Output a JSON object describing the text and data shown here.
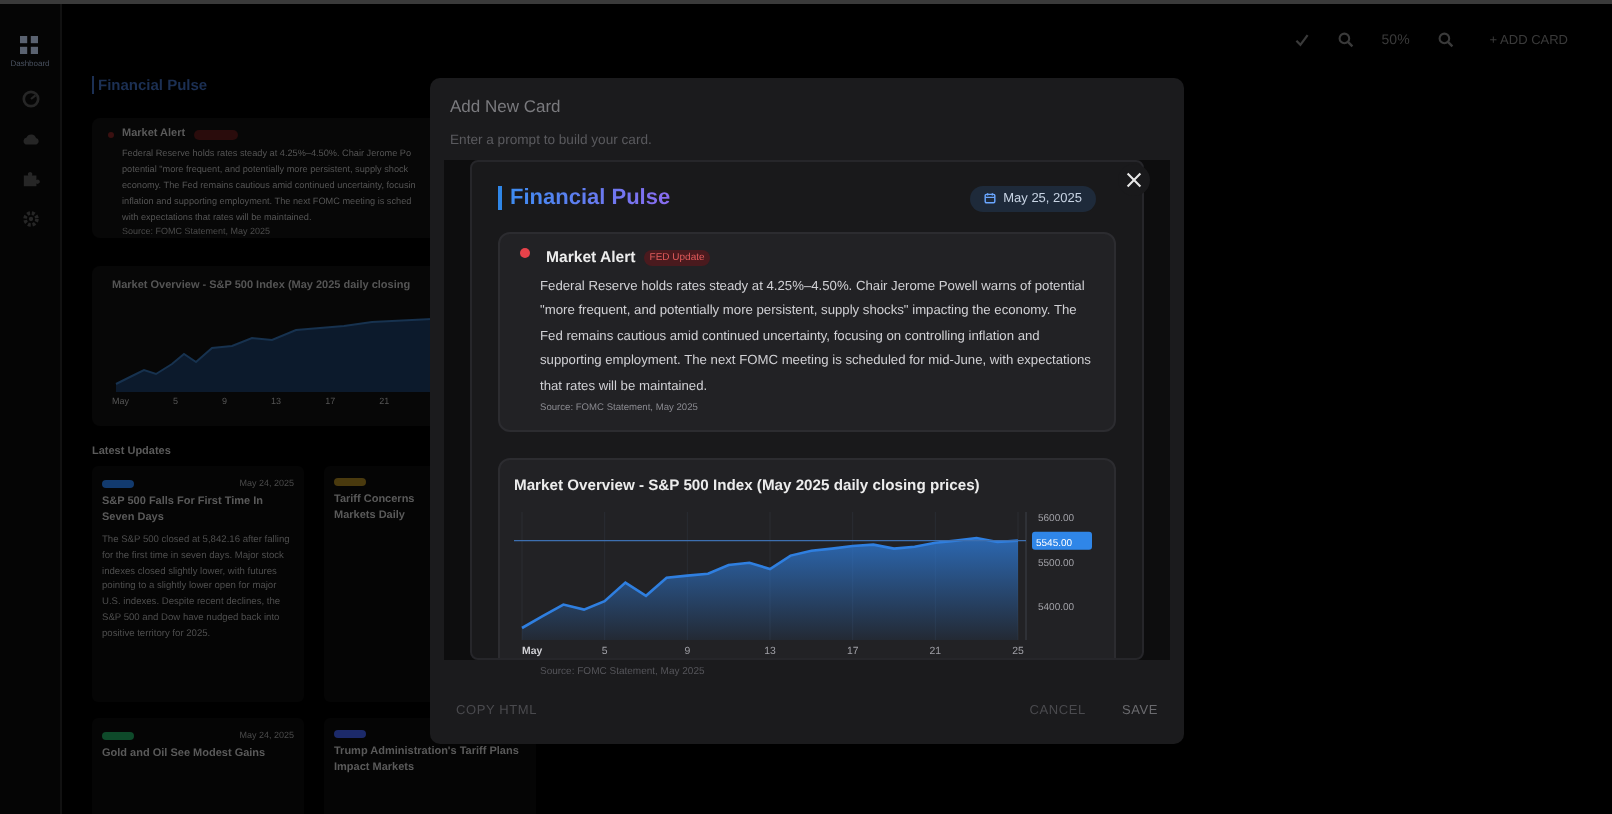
{
  "sidebar": {
    "items": [
      {
        "kind": "grid",
        "label": "Dashboard",
        "selected": true
      },
      {
        "kind": "gauge",
        "selected": false
      },
      {
        "kind": "cloud",
        "selected": false
      },
      {
        "kind": "puzzle",
        "selected": false
      },
      {
        "kind": "gear",
        "selected": false
      }
    ]
  },
  "toolbar": {
    "zoom_level": "50%",
    "add_icon": "+",
    "add_button": "ADD CARD"
  },
  "dashboard": {
    "title": "Financial Pulse",
    "alert": {
      "title": "Market Alert",
      "body_lines": [
        "Federal Reserve holds rates steady at 4.25%–4.50%. Chair Jerome Po",
        "potential \"more frequent, and potentially more persistent, supply shock",
        "economy. The Fed remains cautious amid continued uncertainty, focusin",
        "inflation and supporting employment. The next FOMC meeting is sched",
        "with expectations that rates will be maintained."
      ],
      "source": "Source: FOMC Statement, May 2025"
    },
    "chart": {
      "title": "Market Overview - S&P 500 Index (May 2025 daily closing",
      "axis_labels": [
        "May",
        "5",
        "9",
        "13",
        "17",
        "21"
      ]
    },
    "latest_title": "Latest Updates",
    "updates": [
      {
        "color": "#123a6e",
        "date": "May 24, 2025",
        "title": "S&P 500 Falls For First Time In Seven Days",
        "body": "The S&P 500 closed at 5,842.16 after falling for the first time in seven days. Major stock indexes closed slightly lower, with futures pointing to a slightly lower open for major U.S. indexes. Despite recent declines, the S&P 500 and Dow have nudged back into positive territory for 2025."
      },
      {
        "color": "#4a3a0e",
        "title": "Tariff Concerns",
        "title_2": "Markets Daily"
      },
      {
        "color": "#0e4a2a",
        "date": "May 24, 2025",
        "title": "Gold and Oil See Modest Gains"
      },
      {
        "color": "#1c2a6a",
        "title": "Trump Administration's Tariff Plans Impact Markets"
      }
    ]
  },
  "modal": {
    "title": "Add New Card",
    "subtitle": "Enter a prompt to build your card.",
    "preview": {
      "title": "Financial Pulse",
      "date": "May 25, 2025",
      "alert": {
        "title": "Market Alert",
        "badge": "FED Update",
        "body": "Federal Reserve holds rates steady at 4.25%–4.50%. Chair Jerome Powell warns of potential \"more frequent, and potentially more persistent, supply shocks\" impacting the economy. The Fed remains cautious amid continued uncertainty, focusing on controlling inflation and supporting employment. The next FOMC meeting is scheduled for mid-June, with expectations that rates will be maintained.",
        "source": "Source: FOMC Statement, May 2025"
      },
      "chart": {
        "chart_data": {
          "type": "area",
          "title": "Market Overview - S&P 500 Index (May 2025 daily closing prices)",
          "x": [
            1,
            2,
            3,
            4,
            5,
            6,
            7,
            8,
            9,
            10,
            11,
            12,
            13,
            14,
            15,
            16,
            17,
            18,
            19,
            20,
            21,
            22,
            23,
            24,
            25
          ],
          "series": [
            {
              "color": "#2f7fe0",
              "values": [
                5347,
                5374,
                5400,
                5389,
                5408,
                5450,
                5420,
                5461,
                5466,
                5470,
                5490,
                5495,
                5481,
                5511,
                5522,
                5527,
                5533,
                5536,
                5527,
                5531,
                5540,
                5545,
                5551,
                5542,
                5545
              ]
            }
          ],
          "xlim": [
            1,
            25
          ],
          "ylim": [
            5320,
            5610
          ],
          "grid": true,
          "xticks": [
            {
              "value": 1,
              "label": "May"
            },
            {
              "value": 5,
              "label": "5"
            },
            {
              "value": 9,
              "label": "9"
            },
            {
              "value": 13,
              "label": "13"
            },
            {
              "value": 17,
              "label": "17"
            },
            {
              "value": 21,
              "label": "21"
            },
            {
              "value": 25,
              "label": "25"
            }
          ],
          "yticks": [
            {
              "value": 5400,
              "label": "5400.00"
            },
            {
              "value": 5500,
              "label": "5500.00"
            },
            {
              "value": 5600,
              "label": "5600.00"
            }
          ],
          "ref_lines": [
            {
              "axis": "y",
              "value": 5545,
              "label": "5545.00"
            }
          ]
        }
      }
    },
    "footnote": "Source: FOMC Statement, May 2025",
    "buttons": {
      "copy": "COPY HTML",
      "cancel": "CANCEL",
      "save": "SAVE"
    }
  }
}
